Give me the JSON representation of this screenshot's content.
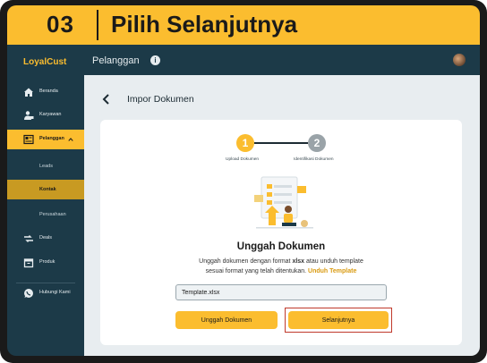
{
  "header": {
    "step_number": "03",
    "step_title": "Pilih Selanjutnya"
  },
  "sidebar": {
    "logo": "LoyalCust",
    "items": [
      {
        "label": "Beranda",
        "icon": "home-icon"
      },
      {
        "label": "Karyawan",
        "icon": "employee-icon"
      },
      {
        "label": "Pelanggan",
        "icon": "customer-icon",
        "active": true
      },
      {
        "label": "Deals",
        "icon": "deals-icon"
      },
      {
        "label": "Produk",
        "icon": "product-icon"
      },
      {
        "label": "Hubungi Kami",
        "icon": "whatsapp-icon"
      }
    ],
    "subitems": [
      {
        "label": "Leads"
      },
      {
        "label": "Kontak",
        "active": true
      },
      {
        "label": "Perusahaan"
      }
    ]
  },
  "topbar": {
    "title": "Pelanggan"
  },
  "page": {
    "title": "Impor Dokumen"
  },
  "stepper": {
    "steps": [
      {
        "number": "1",
        "label": "Upload Dokumen"
      },
      {
        "number": "2",
        "label": "Identifikasi Dokumen"
      }
    ]
  },
  "upload": {
    "title": "Unggah Dokumen",
    "desc_line1_a": "Unggah dokumen dengan format ",
    "desc_line1_format": "xlsx",
    "desc_line1_b": " atau unduh template",
    "desc_line2": "sesuai format yang telah ditentukan.",
    "template_link": "Unduh Template",
    "file_value": "Template.xlsx",
    "upload_button": "Unggah Dokumen",
    "next_button": "Selanjutnya"
  },
  "colors": {
    "accent": "#fbbd2f",
    "sidebar": "#1c3a48",
    "highlight": "#c0392b"
  }
}
